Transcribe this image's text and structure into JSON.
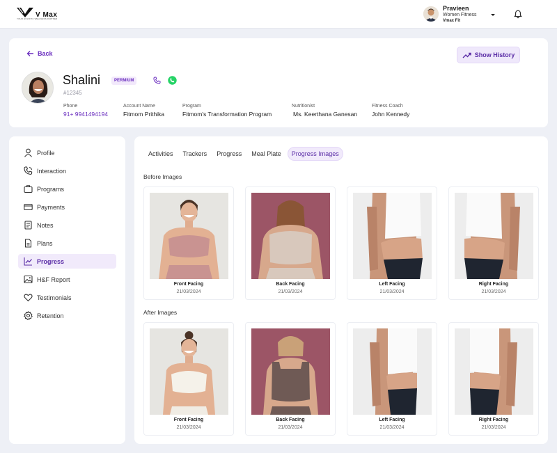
{
  "brand": {
    "name": "V Max",
    "tagline": "YOUR HOLISTIC WELLNESS PARTNER"
  },
  "user": {
    "name": "Pravieen",
    "role": "Women Fitness",
    "org": "Vmax Fit"
  },
  "header": {
    "back_label": "Back",
    "history_label": "Show History"
  },
  "client": {
    "name": "Shalini",
    "badge": "PERMIUM",
    "id": "#12345",
    "fields": [
      {
        "label": "Phone",
        "value": "91+ 9941494194"
      },
      {
        "label": "Account Name",
        "value": "Fitmom Prithika"
      },
      {
        "label": "Program",
        "value": "Fitmom's Transformation Program"
      },
      {
        "label": "Nutritionist",
        "value": "Ms. Keerthana Ganesan"
      },
      {
        "label": "Fitness Coach",
        "value": "John Kennedy"
      }
    ]
  },
  "sidebar": {
    "items": [
      {
        "label": "Profile",
        "icon": "user-icon"
      },
      {
        "label": "Interaction",
        "icon": "phone-icon"
      },
      {
        "label": "Programs",
        "icon": "briefcase-icon"
      },
      {
        "label": "Payments",
        "icon": "card-icon"
      },
      {
        "label": "Notes",
        "icon": "notes-icon"
      },
      {
        "label": "Plans",
        "icon": "document-icon"
      },
      {
        "label": "Progress",
        "icon": "trend-icon",
        "active": true
      },
      {
        "label": "H&F Report",
        "icon": "image-icon"
      },
      {
        "label": "Testimonials",
        "icon": "heart-icon"
      },
      {
        "label": "Retention",
        "icon": "settings-icon"
      }
    ]
  },
  "tabs": [
    "Activities",
    "Trackers",
    "Progress",
    "Meal Plate",
    "Progress Images"
  ],
  "active_tab": "Progress Images",
  "before": {
    "title": "Before Images",
    "photos": [
      {
        "label": "Front Facing",
        "date": "21/03/2024"
      },
      {
        "label": "Back Facing",
        "date": "21/03/2024"
      },
      {
        "label": "Left Facing",
        "date": "21/03/2024"
      },
      {
        "label": "Right Facing",
        "date": "21/03/2024"
      }
    ]
  },
  "after": {
    "title": "After Images",
    "photos": [
      {
        "label": "Front Facing",
        "date": "21/03/2024"
      },
      {
        "label": "Back Facing",
        "date": "21/03/2024"
      },
      {
        "label": "Left Facing",
        "date": "21/03/2024"
      },
      {
        "label": "Right Facing",
        "date": "21/03/2024"
      }
    ]
  },
  "colors": {
    "accent": "#6b2fbf",
    "accent_bg": "#f1eafb",
    "page_bg": "#eef0f6",
    "whatsapp": "#25d366"
  }
}
